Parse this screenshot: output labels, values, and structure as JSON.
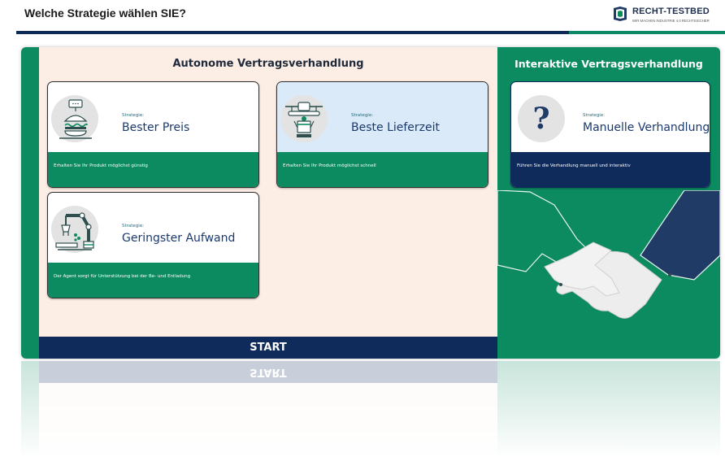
{
  "header": {
    "title": "Welche Strategie wählen SIE?",
    "logo_name": "RECHT-TESTBED",
    "logo_tagline": "WIR MACHEN INDUSTRIE 4.0 RECHTSSICHER"
  },
  "autonomous": {
    "title": "Autonome Vertragsverhandlung",
    "cards": [
      {
        "strategy_label": "Strategie:",
        "name": "Bester Preis",
        "description": "Erhalten Sie Ihr Produkt möglichst günstig",
        "icon": "burger-machine-icon"
      },
      {
        "strategy_label": "Strategie:",
        "name": "Beste Lieferzeit",
        "description": "Erhalten Sie Ihr Produkt möglichst schnell",
        "icon": "drone-icon"
      },
      {
        "strategy_label": "Strategie:",
        "name": "Geringster Aufwand",
        "description": "Der Agent sorgt für Unterstützung bei der Be- und Entladung",
        "icon": "robot-arm-icon"
      }
    ],
    "start_label": "START"
  },
  "interactive": {
    "title": "Interaktive Vertragsverhandlung",
    "card": {
      "strategy_label": "Strategie:",
      "name": "Manuelle Verhandlung",
      "description": "Führen Sie die Verhandlung manuell und interaktiv",
      "icon": "question-mark-icon"
    },
    "illustration": "handshake-icon"
  },
  "colors": {
    "navy": "#0f2b5b",
    "green": "#0c8a60",
    "peach": "#fcede5",
    "selected_card": "#dbeaf8"
  }
}
